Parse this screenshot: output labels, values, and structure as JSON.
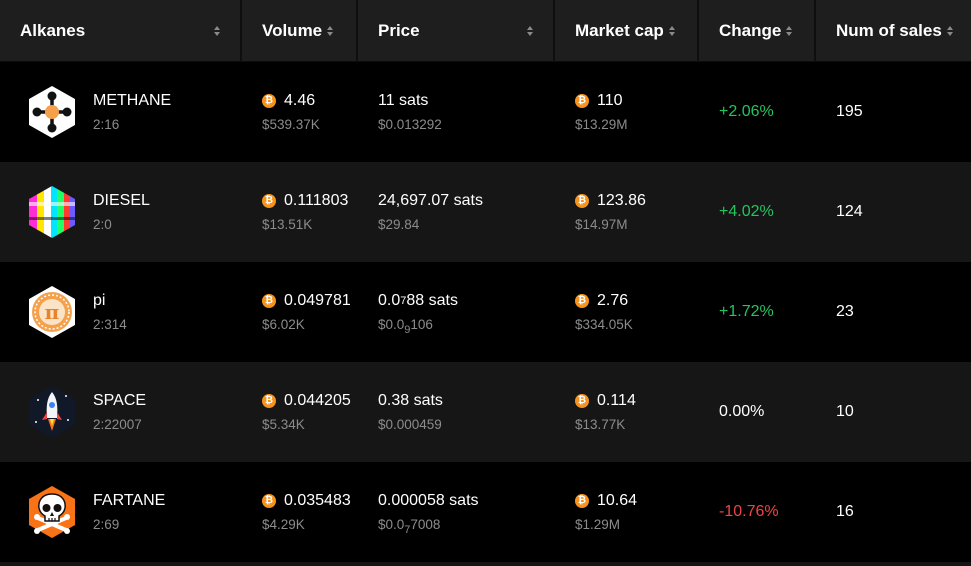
{
  "columns": {
    "alkanes": "Alkanes",
    "volume": "Volume",
    "price": "Price",
    "market_cap": "Market cap",
    "change": "Change",
    "num_sales": "Num of sales"
  },
  "btc_symbol": "₿",
  "colors": {
    "positive": "#22c55e",
    "negative": "#ef4444",
    "bitcoin": "#f7931a"
  },
  "rows": [
    {
      "icon": "methane-molecule-icon",
      "name": "METHANE",
      "id": "2:16",
      "volume_btc": "4.46",
      "volume_usd": "$539.37K",
      "price_sats_a": "11 sats",
      "price_sats_sub": "",
      "price_sats_b": "",
      "price_usd_a": "$0.013292",
      "price_usd_sub": "",
      "price_usd_b": "",
      "mcap_btc": "110",
      "mcap_usd": "$13.29M",
      "change": "+2.06%",
      "change_dir": "positive",
      "sales": "195"
    },
    {
      "icon": "diesel-glitch-icon",
      "name": "DIESEL",
      "id": "2:0",
      "volume_btc": "0.111803",
      "volume_usd": "$13.51K",
      "price_sats_a": "24,697.07 sats",
      "price_sats_sub": "",
      "price_sats_b": "",
      "price_usd_a": "$29.84",
      "price_usd_sub": "",
      "price_usd_b": "",
      "mcap_btc": "123.86",
      "mcap_usd": "$14.97M",
      "change": "+4.02%",
      "change_dir": "positive",
      "sales": "124"
    },
    {
      "icon": "pi-symbol-icon",
      "name": "pi",
      "id": "2:314",
      "volume_btc": "0.049781",
      "volume_usd": "$6.02K",
      "price_sats_a": "0.0",
      "price_sats_sub": "7",
      "price_sats_b": "88 sats",
      "price_usd_a": "$0.0",
      "price_usd_sub": "9",
      "price_usd_b": "106",
      "mcap_btc": "2.76",
      "mcap_usd": "$334.05K",
      "change": "+1.72%",
      "change_dir": "positive",
      "sales": "23"
    },
    {
      "icon": "rocket-icon",
      "name": "SPACE",
      "id": "2:22007",
      "volume_btc": "0.044205",
      "volume_usd": "$5.34K",
      "price_sats_a": "0.38 sats",
      "price_sats_sub": "",
      "price_sats_b": "",
      "price_usd_a": "$0.000459",
      "price_usd_sub": "",
      "price_usd_b": "",
      "mcap_btc": "0.114",
      "mcap_usd": "$13.77K",
      "change": "0.00%",
      "change_dir": "neutral",
      "sales": "10"
    },
    {
      "icon": "skull-crossbones-icon",
      "name": "FARTANE",
      "id": "2:69",
      "volume_btc": "0.035483",
      "volume_usd": "$4.29K",
      "price_sats_a": "0.000058 sats",
      "price_sats_sub": "",
      "price_sats_b": "",
      "price_usd_a": "$0.0",
      "price_usd_sub": "7",
      "price_usd_b": "7008",
      "mcap_btc": "10.64",
      "mcap_usd": "$1.29M",
      "change": "-10.76%",
      "change_dir": "negative",
      "sales": "16"
    }
  ]
}
